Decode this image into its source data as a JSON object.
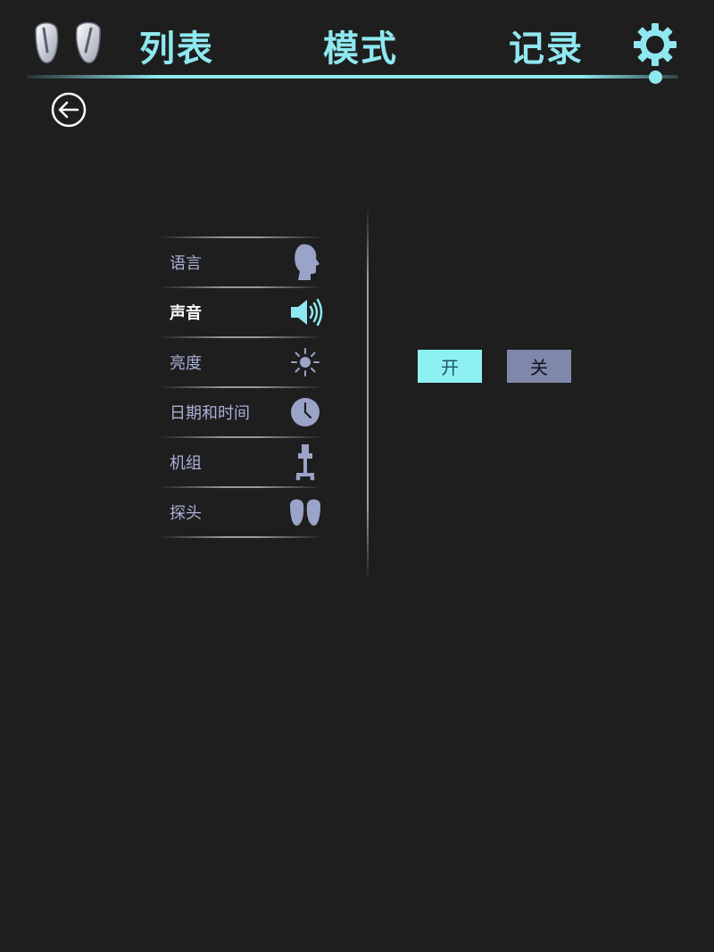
{
  "header": {
    "tabs": [
      {
        "label": "列表"
      },
      {
        "label": "模式"
      },
      {
        "label": "记录"
      }
    ],
    "icons": [
      "probe-pair-icon",
      "gear-icon"
    ],
    "accent_color": "#8fe8ef"
  },
  "back_icon": "back-arrow-icon",
  "menu": {
    "items": [
      {
        "label": "语言",
        "icon": "head-icon",
        "active": false
      },
      {
        "label": "声音",
        "icon": "speaker-icon",
        "active": true
      },
      {
        "label": "亮度",
        "icon": "sun-icon",
        "active": false
      },
      {
        "label": "日期和时间",
        "icon": "clock-icon",
        "active": false
      },
      {
        "label": "机组",
        "icon": "cart-icon",
        "active": false
      },
      {
        "label": "探头",
        "icon": "probe-icon",
        "active": false
      }
    ]
  },
  "sound": {
    "on_label": "开",
    "off_label": "关",
    "selected": "开"
  }
}
